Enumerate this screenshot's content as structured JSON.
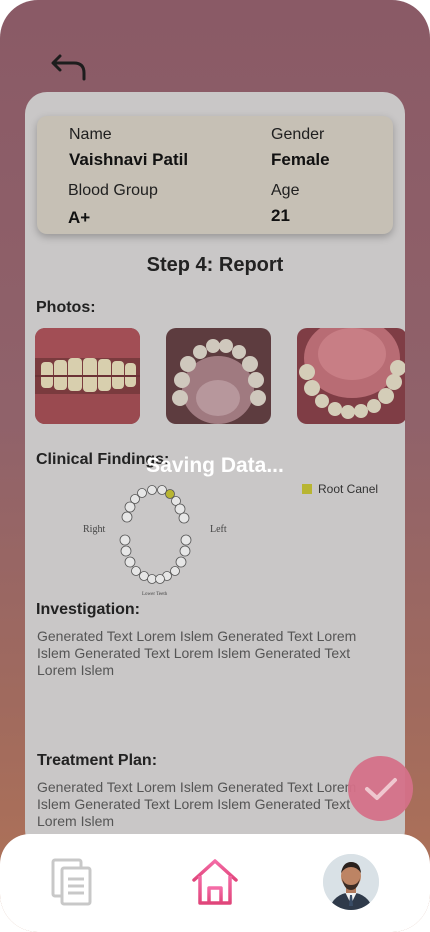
{
  "patient": {
    "name_label": "Name",
    "name_value": "Vaishnavi Patil",
    "gender_label": "Gender",
    "gender_value": "Female",
    "blood_label": "Blood Group",
    "blood_value": "A+",
    "age_label": "Age",
    "age_value": "21"
  },
  "step_title": "Step 4: Report",
  "photos_label": "Photos:",
  "clinical_label": "Clinical Findings:",
  "chart": {
    "legend_label": "Root Canel",
    "legend_color": "#b8b532",
    "right_label": "Right",
    "left_label": "Left",
    "lower_label": "Lower Teeth"
  },
  "investigation": {
    "label": "Investigation:",
    "text": "Generated Text Lorem Islem Generated Text Lorem Islem Generated Text Lorem Islem Generated Text Lorem Islem"
  },
  "treatment": {
    "label": "Treatment Plan:",
    "text": "Generated Text Lorem Islem Generated Text Lorem Islem Generated Text Lorem Islem Generated Text Lorem Islem"
  },
  "overlay": {
    "status_text": "Saving Data..."
  },
  "colors": {
    "accent": "#e0457a",
    "fab": "#d57189"
  },
  "icons": {
    "back": "undo-arrow-icon",
    "confirm": "check-icon",
    "nav_documents": "documents-icon",
    "nav_home": "home-icon"
  }
}
